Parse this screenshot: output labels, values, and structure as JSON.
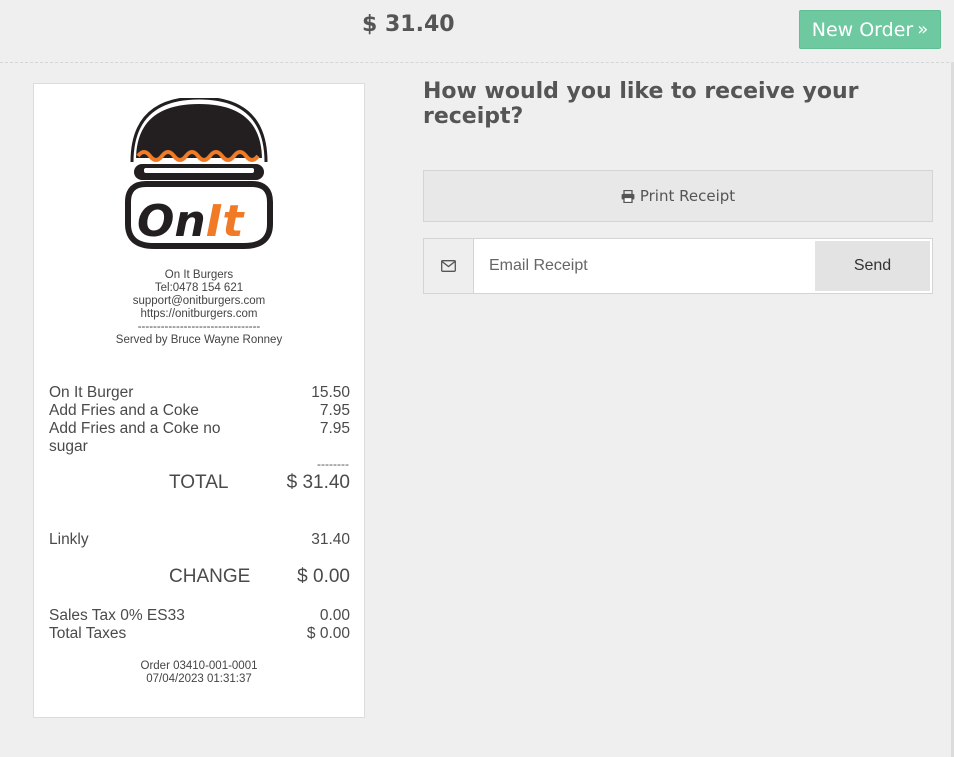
{
  "header": {
    "order_total": "$ 31.40",
    "new_order_label": "New Order",
    "new_order_icon": "double-chevron-right-icon"
  },
  "receipt": {
    "logo_text": "On It",
    "store_name": "On It Burgers",
    "phone": "Tel:0478 154 621",
    "email": "support@onitburgers.com",
    "website": "https://onitburgers.com",
    "divider": "--------------------------------",
    "served_by": "Served by Bruce Wayne Ronney",
    "items": [
      {
        "name": "On It Burger",
        "price": "15.50"
      },
      {
        "name": "Add Fries and a Coke",
        "price": "7.95"
      },
      {
        "name": "Add Fries and a Coke no sugar",
        "price": "7.95"
      }
    ],
    "subtotal_sep": "--------",
    "total_label": "TOTAL",
    "total_value": "$ 31.40",
    "payment": {
      "method": "Linkly",
      "amount": "31.40"
    },
    "change_label": "CHANGE",
    "change_value": "$ 0.00",
    "tax_name": "Sales Tax 0% ES33",
    "tax_value": "0.00",
    "total_taxes_label": "Total Taxes",
    "total_taxes_value": "$ 0.00",
    "order_ref": "Order 03410-001-0001",
    "datetime": "07/04/2023 01:31:37"
  },
  "receipt_options": {
    "question": "How would you like to receive your receipt?",
    "print_label": "Print Receipt",
    "print_icon": "printer-icon",
    "email_icon": "envelope-icon",
    "email_placeholder": "Email Receipt",
    "email_value": "",
    "send_label": "Send"
  },
  "colors": {
    "new_order_bg": "#6ec9a0",
    "logo_orange": "#f07a25",
    "logo_dark": "#231f20"
  }
}
